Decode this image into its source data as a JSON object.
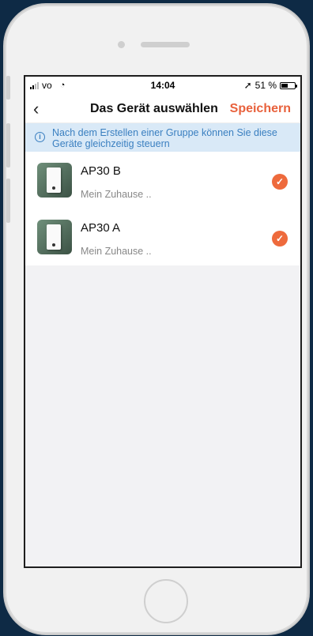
{
  "statusbar": {
    "carrier": "vo",
    "time": "14:04",
    "battery": "51 %",
    "battery_level": 0.51
  },
  "navbar": {
    "back_icon": "chevron-left-icon",
    "title": "Das Gerät auswählen",
    "save_label": "Speichern"
  },
  "info_banner": {
    "icon": "info-icon",
    "text": "Nach dem Erstellen einer Gruppe können Sie diese Geräte gleichzeitig steuern"
  },
  "devices": [
    {
      "name": "AP30 B",
      "location": "Mein Zuhause ..",
      "selected": true
    },
    {
      "name": "AP30 A",
      "location": "Mein Zuhause ..",
      "selected": true
    }
  ],
  "colors": {
    "accent": "#e8613c",
    "info_bg": "#d9e9f7",
    "info_text": "#3a7fc0"
  }
}
